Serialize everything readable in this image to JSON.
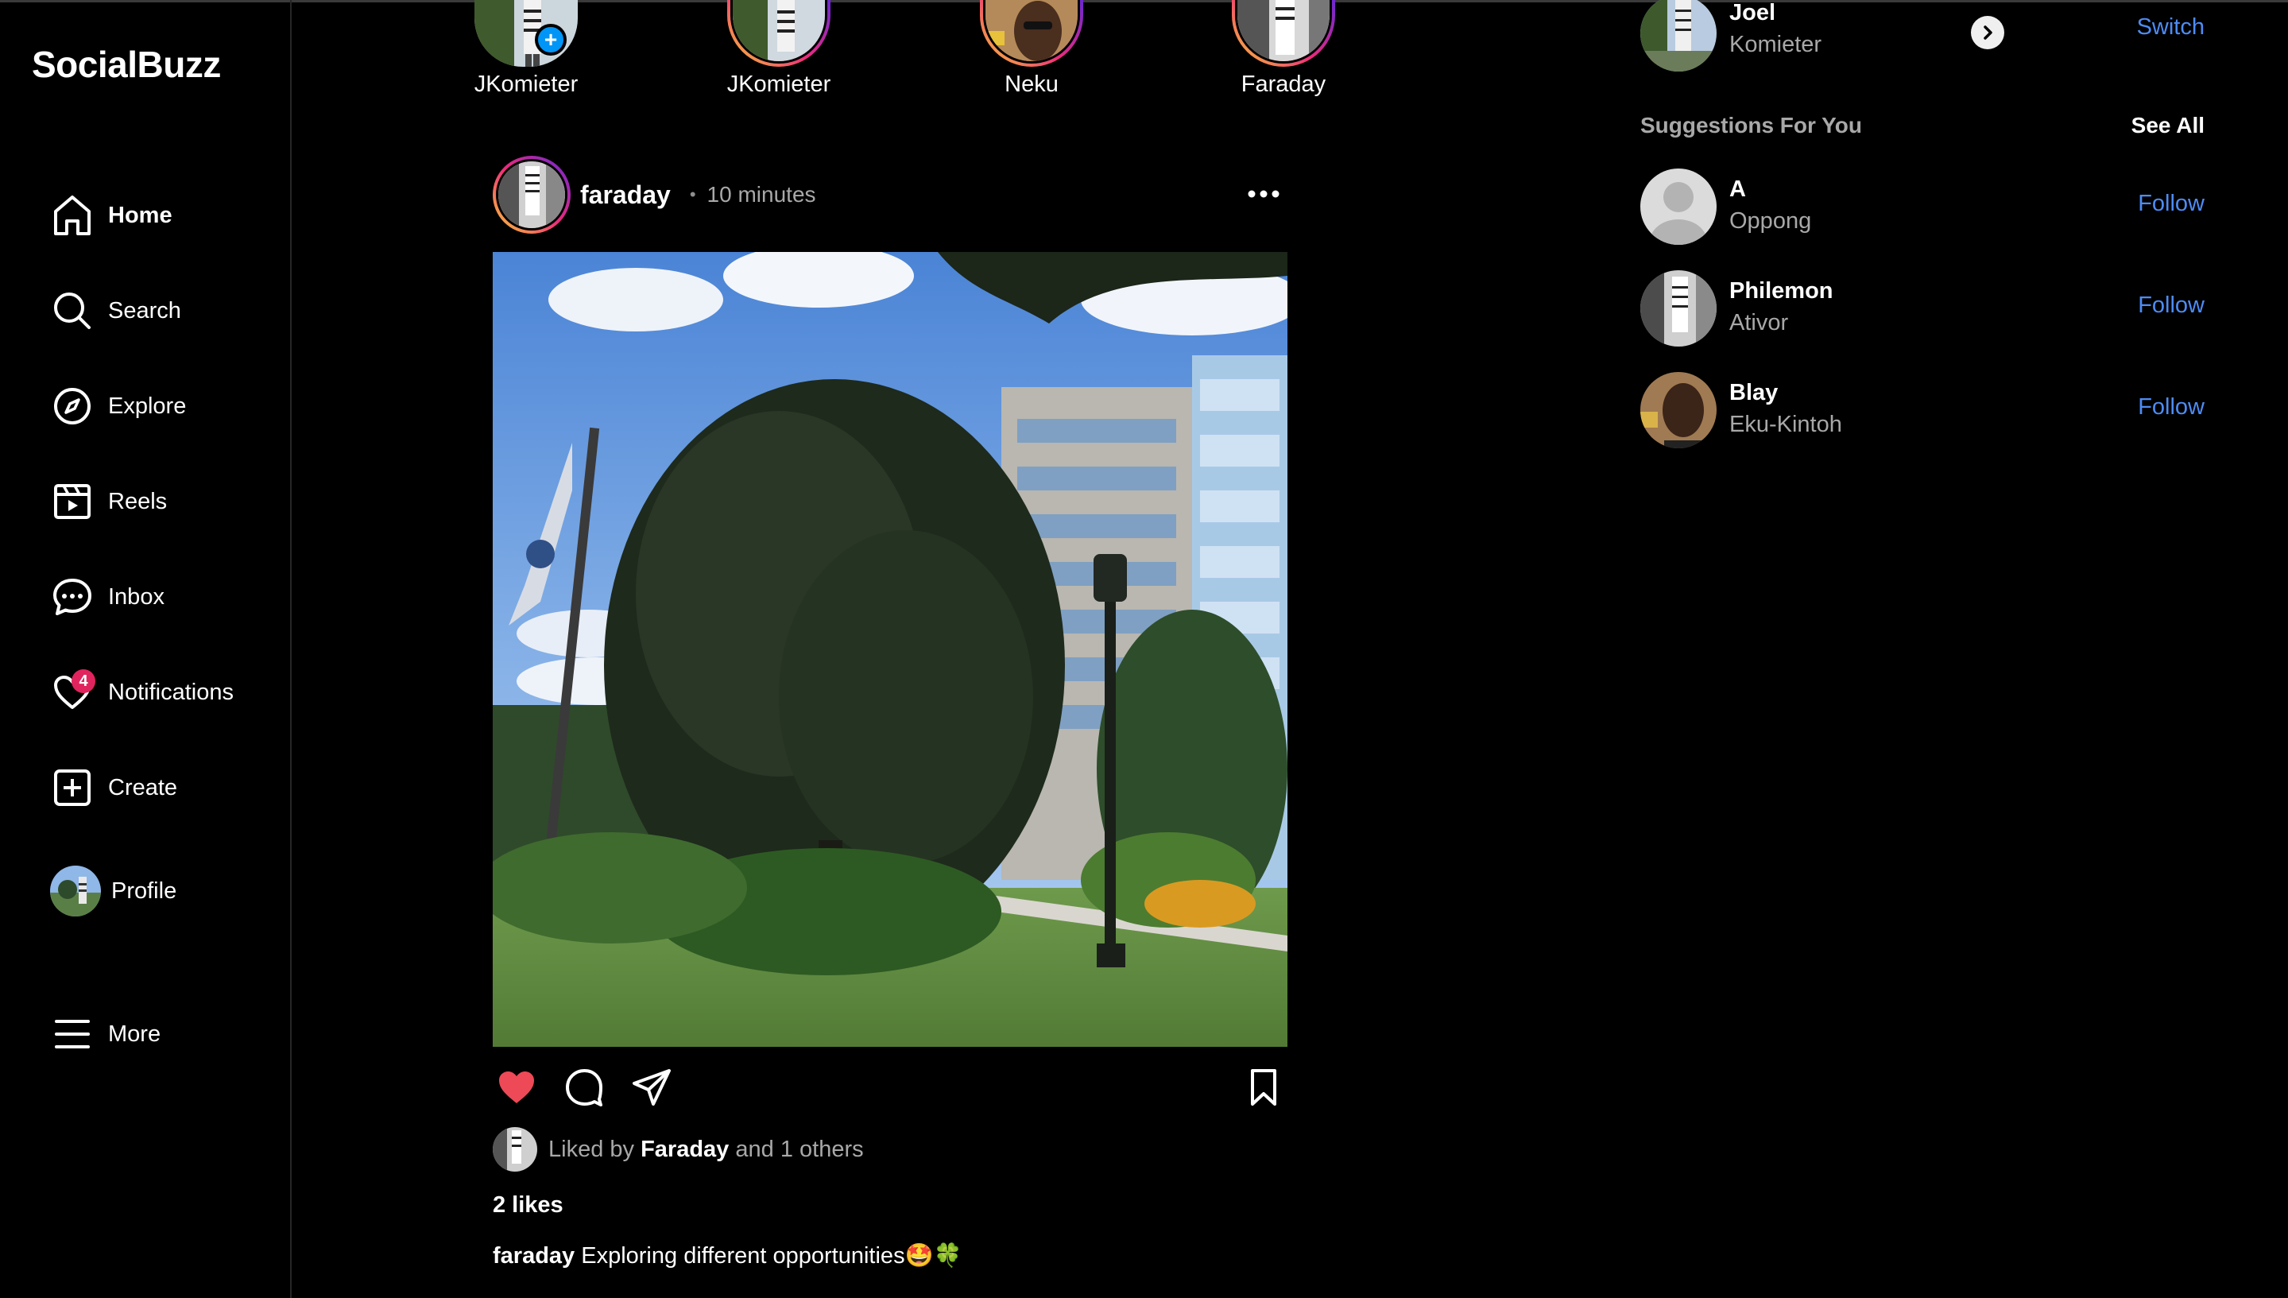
{
  "app": {
    "name": "SocialBuzz"
  },
  "sidebar": {
    "items": [
      {
        "label": "Home",
        "icon": "home-icon",
        "active": true
      },
      {
        "label": "Search",
        "icon": "search-icon"
      },
      {
        "label": "Explore",
        "icon": "compass-icon"
      },
      {
        "label": "Reels",
        "icon": "reels-icon"
      },
      {
        "label": "Inbox",
        "icon": "message-icon"
      },
      {
        "label": "Notifications",
        "icon": "heart-icon",
        "badge": "4"
      },
      {
        "label": "Create",
        "icon": "plus-square-icon"
      },
      {
        "label": "Profile",
        "icon": "avatar"
      },
      {
        "label": "More",
        "icon": "menu-icon"
      }
    ]
  },
  "stories": [
    {
      "name": "JKomieter",
      "own": true
    },
    {
      "name": "JKomieter"
    },
    {
      "name": "Neku"
    },
    {
      "name": "Faraday"
    }
  ],
  "post": {
    "username": "faraday",
    "separator": "•",
    "time": "10 minutes",
    "liked_prefix": "Liked by",
    "liked_user": "Faraday",
    "liked_suffix": "and 1 others",
    "likes": "2 likes",
    "caption_user": "faraday",
    "caption_text": "Exploring different opportunities🤩🍀"
  },
  "current_user": {
    "first": "Joel",
    "last": "Komieter",
    "action": "Switch"
  },
  "suggestions": {
    "title": "Suggestions For You",
    "see_all": "See All",
    "items": [
      {
        "first": "A",
        "last": "Oppong",
        "action": "Follow"
      },
      {
        "first": "Philemon",
        "last": "Ativor",
        "action": "Follow"
      },
      {
        "first": "Blay",
        "last": "Eku-Kintoh",
        "action": "Follow"
      }
    ]
  },
  "colors": {
    "accent": "#4d8cf5",
    "like": "#ed4956",
    "badge": "#e0245e"
  }
}
